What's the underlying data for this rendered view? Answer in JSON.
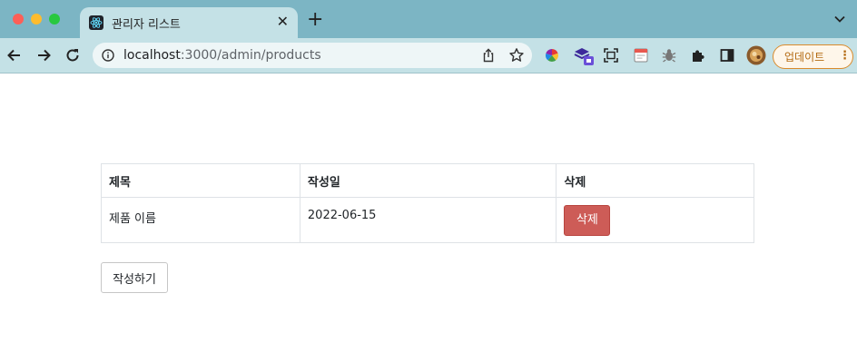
{
  "browser": {
    "tab": {
      "title": "관리자 리스트",
      "icon": "react-icon",
      "close_label": "✕"
    },
    "new_tab_label": "+",
    "address": {
      "host": "localhost",
      "path": ":3000/admin/products"
    },
    "extensions": [
      "color-wheel-icon",
      "stack-icon",
      "screenshot-icon",
      "calendar-icon",
      "bug-icon",
      "puzzle-icon",
      "sidepanel-icon",
      "avatar"
    ],
    "update_button": {
      "label": "업데이트",
      "dots": "⋮"
    },
    "colors": {
      "tabstrip": "#7cb5c4",
      "toolbar": "#c4e1e6",
      "update_accent": "#d98b2d"
    }
  },
  "page": {
    "table": {
      "headers": [
        "제목",
        "작성일",
        "삭제"
      ],
      "rows": [
        {
          "title": "제품 이름",
          "date": "2022-06-15",
          "delete_label": "삭제"
        }
      ]
    },
    "write_button_label": "작성하기",
    "colors": {
      "delete_button": "#cd5c57",
      "border": "#dee2e6"
    }
  }
}
